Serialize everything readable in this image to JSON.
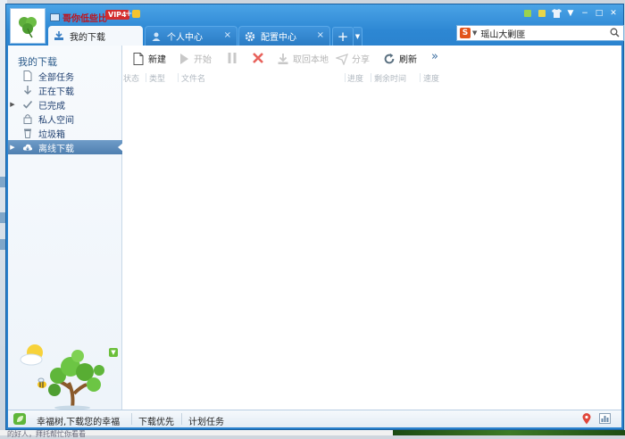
{
  "app": {
    "username": "哥你低些比",
    "vip_label": "VIP4",
    "vip_plus": "+"
  },
  "tabs": [
    {
      "label": "我的下载",
      "active": true,
      "icon": "download-icon"
    },
    {
      "label": "个人中心",
      "active": false,
      "icon": "person-icon",
      "close": "×"
    },
    {
      "label": "配置中心",
      "active": false,
      "icon": "gear-icon",
      "close": "×"
    }
  ],
  "tab_add": "+",
  "search": {
    "engine_logo": "S",
    "value": "瑶山大剿匪"
  },
  "sidebar": {
    "heading": "我的下载",
    "items": [
      {
        "label": "全部任务",
        "icon": "document-icon"
      },
      {
        "label": "正在下载",
        "icon": "arrow-down-icon"
      },
      {
        "label": "已完成",
        "icon": "check-icon"
      },
      {
        "label": "私人空间",
        "icon": "lock-icon"
      },
      {
        "label": "垃圾箱",
        "icon": "trash-icon"
      },
      {
        "label": "离线下载",
        "icon": "cloud-icon",
        "selected": true
      }
    ]
  },
  "toolbar": {
    "new": "新建",
    "start": "开始",
    "pause": "",
    "delete": "",
    "fetch_local": "取回本地",
    "share": "分享",
    "refresh": "刷新",
    "more": "»"
  },
  "columns": [
    "状态",
    "类型",
    "文件名",
    "进度",
    "剩余时间",
    "速度"
  ],
  "statusbar": {
    "slogan": "幸福树,下载您的幸福",
    "download_priority": "下载优先",
    "scheduled_tasks": "计划任务"
  },
  "background_fragment": "的好人，拜托帮忙你看看",
  "colors": {
    "titlebar": "#2d87d3",
    "selected_item": "#5a8ab9",
    "username": "#c0121a",
    "vip": "#d42d2d"
  }
}
